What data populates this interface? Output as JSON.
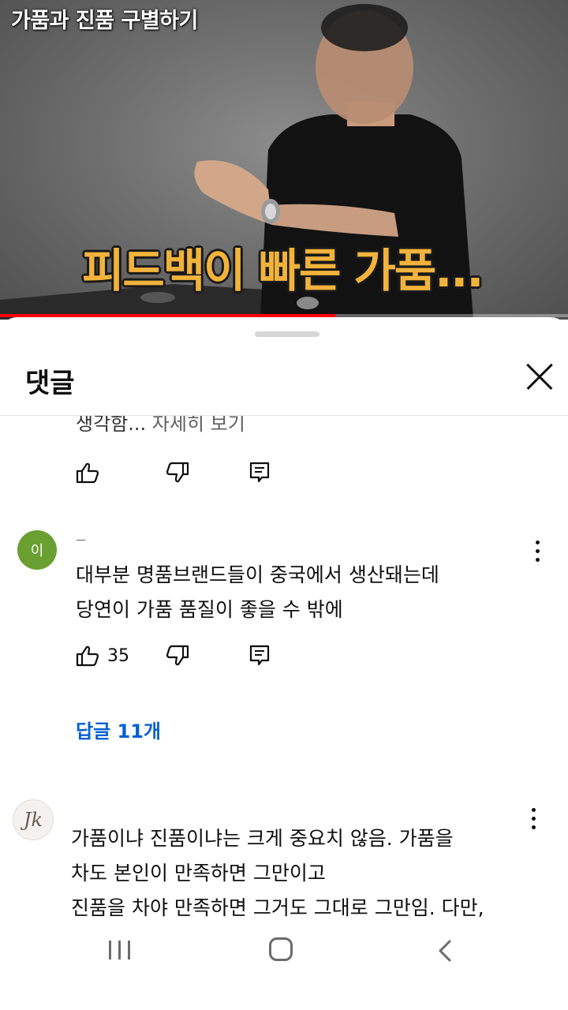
{
  "video": {
    "title_overlay": "가품과 진품 구별하기",
    "caption": "피드백이 빠른 가품...",
    "progress_fraction": 0.59
  },
  "sheet": {
    "title": "댓글",
    "close_icon": "close-icon"
  },
  "comments": [
    {
      "clipped_text": "생각함... ",
      "more_label": "자세히 보기",
      "likes": "",
      "icons": [
        "thumb-up-icon",
        "thumb-down-icon",
        "reply-icon"
      ]
    },
    {
      "avatar_initial": "이",
      "author": "ㅡ",
      "text": "대부분 명품브랜드들이 중국에서 생산돼는데\n당연이 가품 품질이 좋을 수 밖에",
      "likes": "35",
      "replies_label": "답글 11개",
      "avatar_color": "#6a9f32"
    },
    {
      "avatar_initial": "Jk",
      "text": "가품이냐 진품이냐는 크게 중요치 않음.  가품을\n차도 본인이 만족하면 그만이고\n진품을 차야 만족하면 그거도 그대로 그만임. 다만,"
    }
  ],
  "colors": {
    "accent_link": "#065fd4",
    "progress": "#ff0000",
    "caption": "#f2b33c"
  },
  "navbar": {
    "icons": [
      "recents-icon",
      "home-icon",
      "back-icon"
    ]
  }
}
